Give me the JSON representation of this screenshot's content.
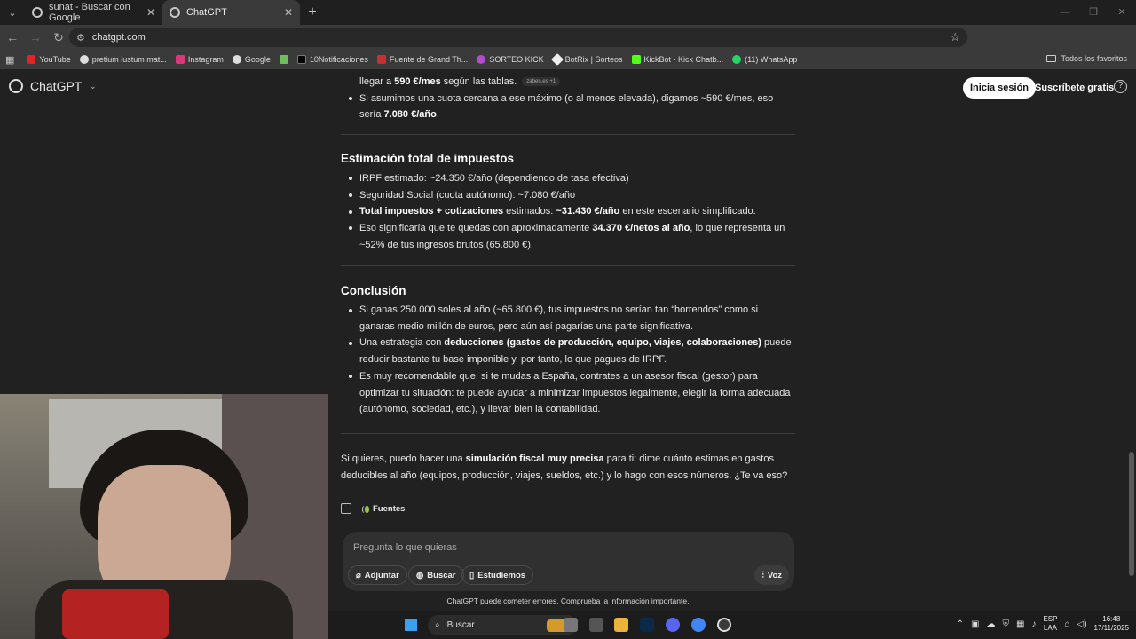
{
  "browser": {
    "tabs": [
      {
        "title": "sunat - Buscar con Google"
      },
      {
        "title": "ChatGPT"
      }
    ],
    "url": "chatgpt.com",
    "bookmarks": [
      "YouTube",
      "pretium iustum mat...",
      "Instagram",
      "Google",
      "10Notificaciones",
      "Fuente de Grand Th...",
      "SORTEO KICK",
      "BotRix | Sorteos",
      "KickBot - Kick Chatb...",
      "(11) WhatsApp"
    ],
    "all_bookmarks": "Todos los favoritos"
  },
  "header": {
    "brand": "ChatGPT",
    "login": "Inicia sesión",
    "subscribe": "Suscríbete gratis"
  },
  "content": {
    "top_line_pre": "llegar a ",
    "top_line_bold": "590 €/mes",
    "top_line_post": " según las tablas.",
    "top_chip": "zaben.es  +1",
    "top_bullet": "Si asumimos una cuota cercana a ese máximo (o al menos elevada), digamos ~590 €/mes, eso sería ",
    "top_bullet_bold": "7.080 €/año",
    "top_bullet_end": ".",
    "section1_title": "Estimación total de impuestos",
    "s1_b1": "IRPF estimado: ~24.350 €/año (dependiendo de tasa efectiva)",
    "s1_b2": "Seguridad Social (cuota autónomo): ~7.080 €/año",
    "s1_b3_bold1": "Total impuestos + cotizaciones",
    "s1_b3_mid": " estimados: ",
    "s1_b3_bold2": "~31.430 €/año",
    "s1_b3_end": " en este escenario simplificado.",
    "s1_b4_pre": "Eso significaría que te quedas con aproximadamente ",
    "s1_b4_bold": "34.370 €/netos al año",
    "s1_b4_end": ", lo que representa un ~52% de tus ingresos brutos (65.800 €).",
    "section2_title": "Conclusión",
    "s2_b1": "Si ganas 250.000 soles al año (~65.800 €), tus impuestos no serían tan “horrendos” como si ganaras medio millón de euros, pero aún así pagarías una parte significativa.",
    "s2_b2_pre": "Una estrategia con ",
    "s2_b2_bold": "deducciones (gastos de producción, equipo, viajes, colaboraciones)",
    "s2_b2_end": " puede reducir bastante tu base imponible y, por tanto, lo que pagues de IRPF.",
    "s2_b3": "Es muy recomendable que, si te mudas a España, contrates a un asesor fiscal (gestor) para optimizar tu situación: te puede ayudar a minimizar impuestos legalmente, elegir la forma adecuada (autónomo, sociedad, etc.), y llevar bien la contabilidad.",
    "closing_pre": "Si quieres, puedo hacer una ",
    "closing_bold": "simulación fiscal muy precisa",
    "closing_end": " para ti: dime cuánto estimas en gastos deducibles al año (equipos, producción, viajes, sueldos, etc.) y lo hago con esos números. ¿Te va eso?",
    "sources": "Fuentes"
  },
  "composer": {
    "placeholder": "Pregunta lo que quieras",
    "attach": "Adjuntar",
    "search": "Buscar",
    "study": "Estudiemos",
    "voice": "Voz"
  },
  "footer_note": "ChatGPT puede cometer errores. Comprueba la información importante.",
  "taskbar": {
    "search": "Buscar",
    "lang_line1": "ESP",
    "lang_line2": "LAA",
    "time": "16:48",
    "date": "17/11/2025"
  }
}
